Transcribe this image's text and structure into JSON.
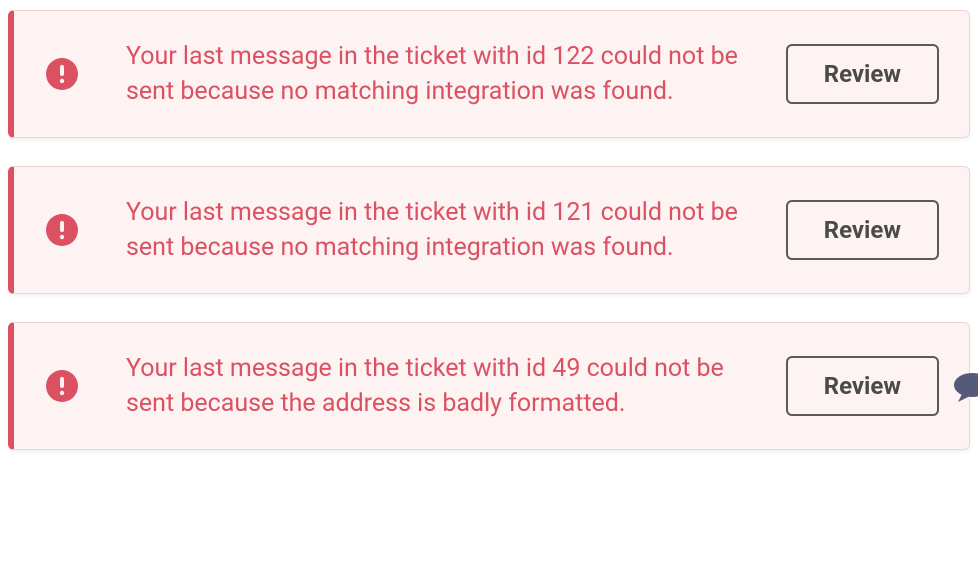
{
  "notifications": [
    {
      "message": "Your last message in the ticket with id 122 could not be sent because no matching integration was found.",
      "action_label": "Review"
    },
    {
      "message": "Your last message in the ticket with id 121 could not be sent because no matching integration was found.",
      "action_label": "Review"
    },
    {
      "message": "Your last message in the ticket with id 49 could not be sent because the address is badly formatted.",
      "action_label": "Review"
    }
  ]
}
